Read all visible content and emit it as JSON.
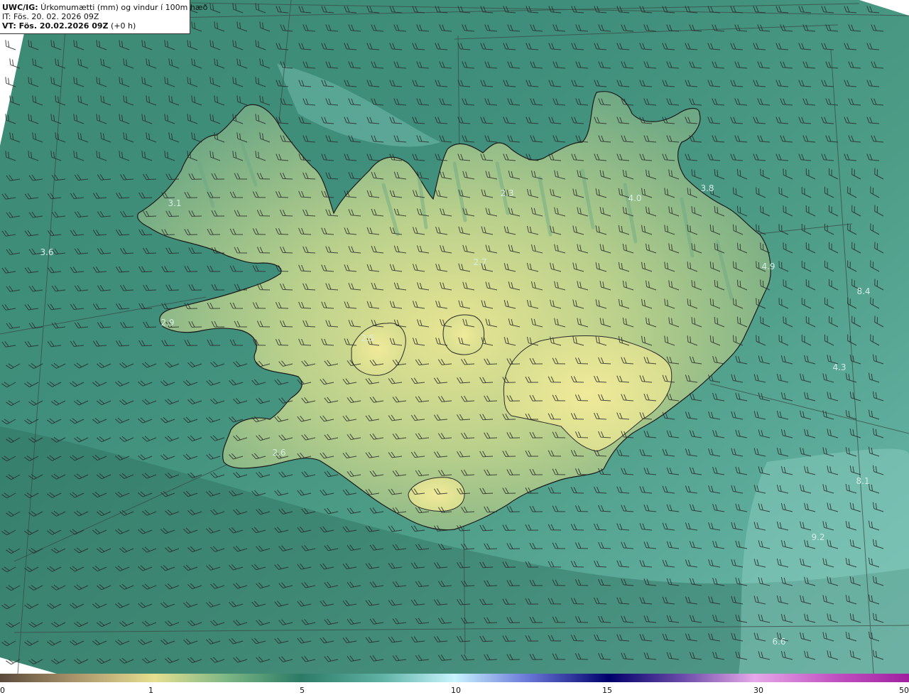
{
  "header": {
    "model": "UWC/IG:",
    "title_rest": " Úrkomumætti (mm) og vindur í 100m hæð",
    "it_line": "IT: Fös. 20. 02. 2026 09Z",
    "vt_label": "VT: Fös. 20.02.2026 09Z",
    "vt_suffix": " (+0 h)"
  },
  "colorbar": {
    "ticks": [
      "0",
      "1",
      "5",
      "10",
      "15",
      "30",
      "50"
    ],
    "colors": [
      "#5a4a3a",
      "#b8a070",
      "#e8e090",
      "#3aa07a",
      "#2a7a6a",
      "#bfefff",
      "#4040c0",
      "#00006a",
      "#a060c0",
      "#f0a0e0",
      "#a020a0"
    ]
  },
  "value_labels": [
    "3.1",
    "3.6",
    "2.3",
    "4.0",
    "3.8",
    "2.7",
    "4.9",
    "8.4",
    "2.9",
    "2.5",
    "4.3",
    "2.6",
    "8.1",
    "9.2",
    "6.6"
  ],
  "colors": {
    "sea_dark": "#2a6b63",
    "sea_light": "#5fae9c",
    "land_high": "#e6e38e",
    "land_mid": "#9dc28a",
    "coast": "#1a1a1a"
  }
}
